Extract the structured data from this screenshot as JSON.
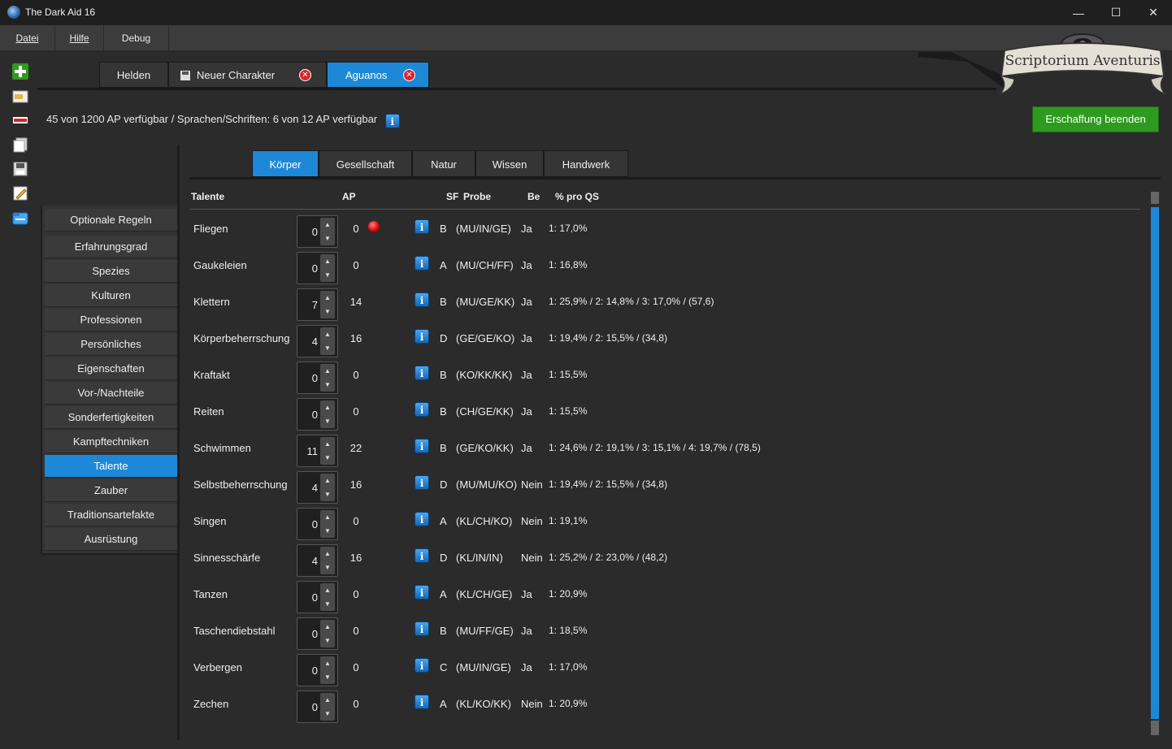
{
  "window": {
    "title": "The Dark Aid 16",
    "minimize": "—",
    "maximize": "☐",
    "close": "✕"
  },
  "menu": [
    {
      "label": "Datei"
    },
    {
      "label": "Hilfe"
    },
    {
      "label": "Debug"
    }
  ],
  "logo": {
    "text": "Scriptorium Aventuris"
  },
  "toolbar": [
    "add-icon",
    "open-folder-icon",
    "remove-icon",
    "copy-icon",
    "save-icon",
    "edit-icon",
    "folder-icon"
  ],
  "tabs": [
    {
      "label": "Helden",
      "active": false,
      "closable": false
    },
    {
      "label": "Neuer Charakter",
      "active": false,
      "closable": true
    },
    {
      "label": "Aguanos",
      "active": true,
      "closable": true
    }
  ],
  "ap_info": "45 von 1200 AP verfügbar / Sprachen/Schriften: 6 von 12 AP verfügbar",
  "finish_button": "Erschaffung beenden",
  "nav": [
    "Optionale Regeln",
    "Erfahrungsgrad",
    "Spezies",
    "Kulturen",
    "Professionen",
    "Persönliches",
    "Eigenschaften",
    "Vor-/Nachteile",
    "Sonderfertigkeiten",
    "Kampftechniken",
    "Talente",
    "Zauber",
    "Traditionsartefakte",
    "Ausrüstung"
  ],
  "nav_active": "Talente",
  "subtabs": [
    "Körper",
    "Gesellschaft",
    "Natur",
    "Wissen",
    "Handwerk"
  ],
  "subtab_active": "Körper",
  "table": {
    "headers": {
      "talent": "Talente",
      "ap": "AP",
      "sf": "SF",
      "probe": "Probe",
      "be": "Be",
      "qs": "% pro QS"
    },
    "rows": [
      {
        "name": "Fliegen",
        "value": "0",
        "ap": "0",
        "warn": true,
        "sf": "B",
        "probe": "(MU/IN/GE)",
        "be": "Ja",
        "qs": "1: 17,0%"
      },
      {
        "name": "Gaukeleien",
        "value": "0",
        "ap": "0",
        "warn": false,
        "sf": "A",
        "probe": "(MU/CH/FF)",
        "be": "Ja",
        "qs": "1: 16,8%"
      },
      {
        "name": "Klettern",
        "value": "7",
        "ap": "14",
        "warn": false,
        "sf": "B",
        "probe": "(MU/GE/KK)",
        "be": "Ja",
        "qs": "1: 25,9% / 2: 14,8% / 3: 17,0% / (57,6)"
      },
      {
        "name": "Körperbeherrschung",
        "value": "4",
        "ap": "16",
        "warn": false,
        "sf": "D",
        "probe": "(GE/GE/KO)",
        "be": "Ja",
        "qs": "1: 19,4% / 2: 15,5% / (34,8)"
      },
      {
        "name": "Kraftakt",
        "value": "0",
        "ap": "0",
        "warn": false,
        "sf": "B",
        "probe": "(KO/KK/KK)",
        "be": "Ja",
        "qs": "1: 15,5%"
      },
      {
        "name": "Reiten",
        "value": "0",
        "ap": "0",
        "warn": false,
        "sf": "B",
        "probe": "(CH/GE/KK)",
        "be": "Ja",
        "qs": "1: 15,5%"
      },
      {
        "name": "Schwimmen",
        "value": "11",
        "ap": "22",
        "warn": false,
        "sf": "B",
        "probe": "(GE/KO/KK)",
        "be": "Ja",
        "qs": "1: 24,6% / 2: 19,1% / 3: 15,1% / 4: 19,7% / (78,5)"
      },
      {
        "name": "Selbstbeherrschung",
        "value": "4",
        "ap": "16",
        "warn": false,
        "sf": "D",
        "probe": "(MU/MU/KO)",
        "be": "Nein",
        "qs": "1: 19,4% / 2: 15,5% / (34,8)"
      },
      {
        "name": "Singen",
        "value": "0",
        "ap": "0",
        "warn": false,
        "sf": "A",
        "probe": "(KL/CH/KO)",
        "be": "Nein",
        "qs": "1: 19,1%"
      },
      {
        "name": "Sinnesschärfe",
        "value": "4",
        "ap": "16",
        "warn": false,
        "sf": "D",
        "probe": "(KL/IN/IN)",
        "be": "Nein",
        "qs": "1: 25,2% / 2: 23,0% / (48,2)"
      },
      {
        "name": "Tanzen",
        "value": "0",
        "ap": "0",
        "warn": false,
        "sf": "A",
        "probe": "(KL/CH/GE)",
        "be": "Ja",
        "qs": "1: 20,9%"
      },
      {
        "name": "Taschendiebstahl",
        "value": "0",
        "ap": "0",
        "warn": false,
        "sf": "B",
        "probe": "(MU/FF/GE)",
        "be": "Ja",
        "qs": "1: 18,5%"
      },
      {
        "name": "Verbergen",
        "value": "0",
        "ap": "0",
        "warn": false,
        "sf": "C",
        "probe": "(MU/IN/GE)",
        "be": "Ja",
        "qs": "1: 17,0%"
      },
      {
        "name": "Zechen",
        "value": "0",
        "ap": "0",
        "warn": false,
        "sf": "A",
        "probe": "(KL/KO/KK)",
        "be": "Nein",
        "qs": "1: 20,9%"
      }
    ]
  },
  "colors": {
    "accent": "#1e88d8",
    "finish": "#2f9a20",
    "warn": "#d10000"
  }
}
